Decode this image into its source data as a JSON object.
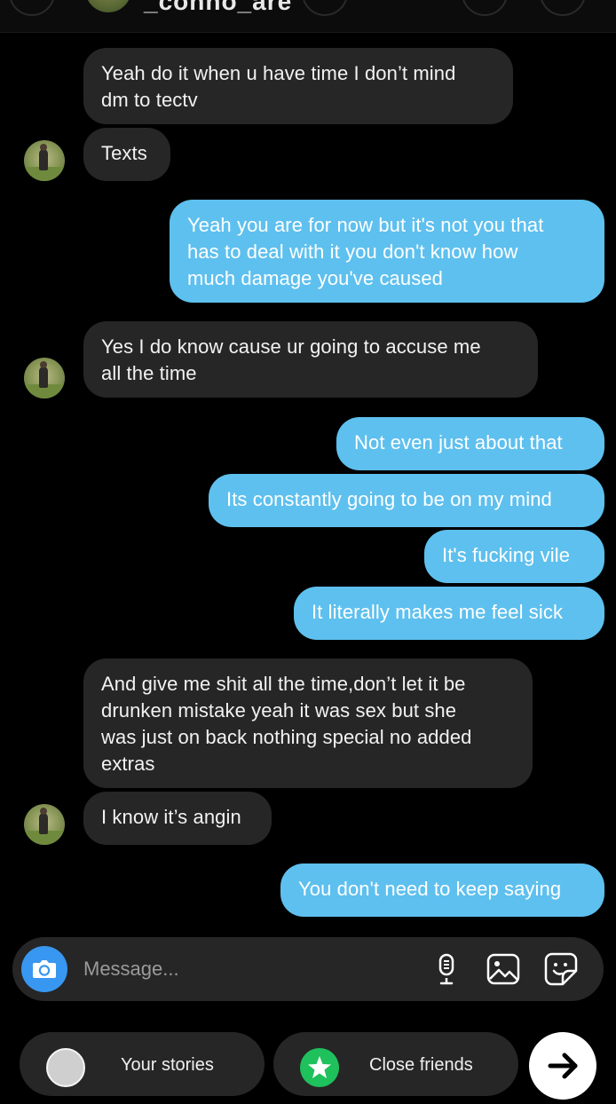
{
  "header": {
    "title": "_conno_are"
  },
  "messages": [
    {
      "from": "them",
      "text": "Yeah do it when u have time I don’t mind\ndm to tectv"
    },
    {
      "from": "them",
      "text": "Texts"
    },
    {
      "from": "me",
      "text": "Yeah you are for now but it's not you that\nhas to deal with it you don't know how\nmuch damage you've caused"
    },
    {
      "from": "them",
      "text": "Yes I do know cause ur going to accuse me\nall the time"
    },
    {
      "from": "me",
      "text": "Not even just about that"
    },
    {
      "from": "me",
      "text": "Its constantly going to be on my mind"
    },
    {
      "from": "me",
      "text": "It's fucking vile"
    },
    {
      "from": "me",
      "text": "It literally makes me feel sick"
    },
    {
      "from": "them",
      "text": "And give me shit all the time,don’t let it be\ndrunken mistake yeah it was sex but she\nwas just on back nothing special no added\nextras"
    },
    {
      "from": "them",
      "text": "I know it’s angin"
    },
    {
      "from": "me",
      "text": "You don't need to keep saying"
    }
  ],
  "composer": {
    "placeholder": "Message...",
    "icons": [
      "camera-icon",
      "microphone-icon",
      "gallery-icon",
      "sticker-icon"
    ]
  },
  "share_bar": {
    "your_stories_label": "Your stories",
    "close_friends_label": "Close friends"
  },
  "colors": {
    "sent_bubble": "#5ec0ee",
    "received_bubble": "#262626",
    "camera_button": "#3897f0",
    "close_friends_green": "#1ec15b"
  }
}
